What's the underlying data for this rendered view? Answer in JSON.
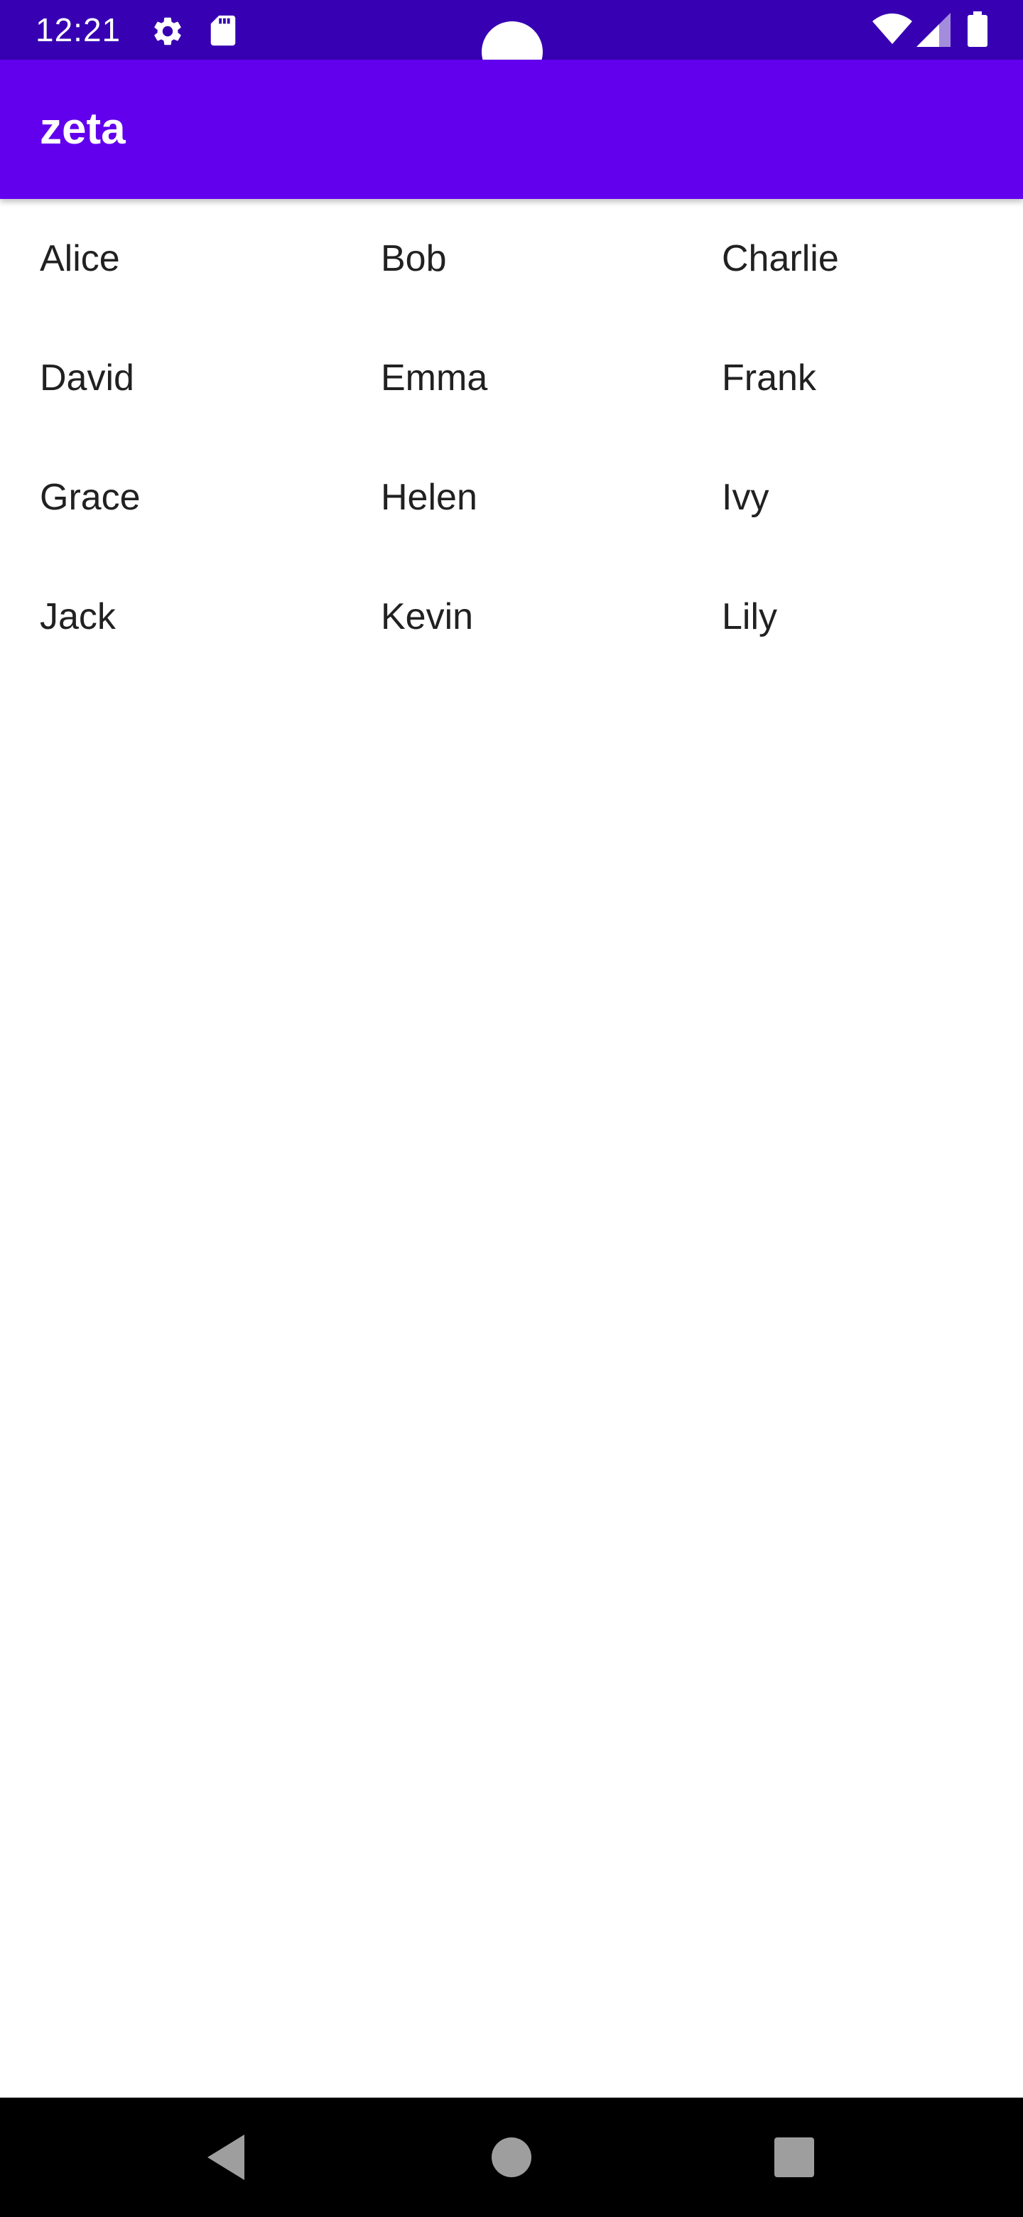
{
  "status_bar": {
    "time": "12:21",
    "icons": [
      "settings-icon",
      "sd-card-icon",
      "wifi-icon",
      "signal-icon",
      "battery-icon"
    ],
    "background": "#3700b3"
  },
  "app_bar": {
    "title": "zeta",
    "background": "#6200ee"
  },
  "grid": {
    "rows": [
      [
        "Alice",
        "Bob",
        "Charlie"
      ],
      [
        "David",
        "Emma",
        "Frank"
      ],
      [
        "Grace",
        "Helen",
        "Ivy"
      ],
      [
        "Jack",
        "Kevin",
        "Lily"
      ]
    ]
  },
  "nav_bar": {
    "buttons": [
      "back-icon",
      "home-icon",
      "recents-icon"
    ],
    "background": "#000000"
  }
}
